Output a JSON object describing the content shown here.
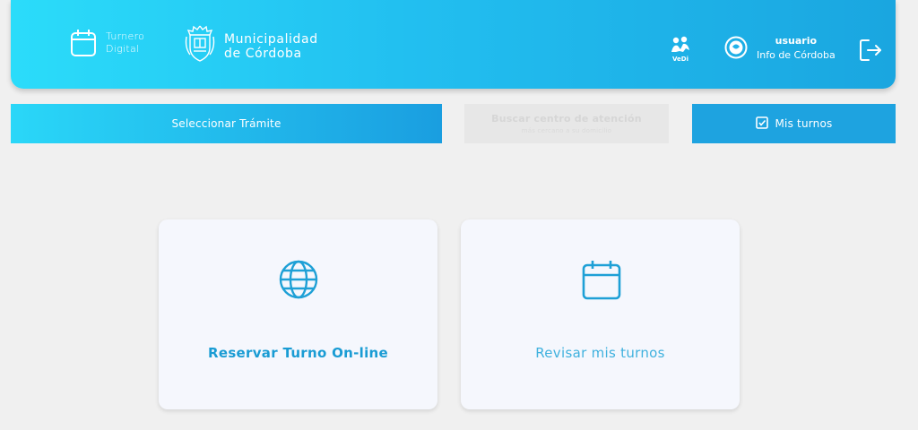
{
  "header": {
    "app_name_line1": "Turnero",
    "app_name_line2": "Digital",
    "municipality_line1": "Municipalidad",
    "municipality_line2": "de Córdoba",
    "vedi_label": "VeDi",
    "user_name": "usuario",
    "user_subtitle": "Info de Córdoba"
  },
  "nav": {
    "select_procedure": "Seleccionar Trámite",
    "center_title": "Buscar centro de atención",
    "center_subtitle": "más cercano a su domicilio",
    "my_appointments": "Mis turnos"
  },
  "cards": {
    "book_online": "Reservar Turno On-line",
    "review_appointments": "Revisar mis turnos"
  },
  "icons": {
    "app": "calendar-icon",
    "crest": "municipal-crest-icon",
    "vedi": "vedi-logo-icon",
    "avatar": "user-avatar-icon",
    "logout": "logout-icon",
    "check": "check-square-icon",
    "globe": "globe-icon",
    "calendar": "calendar-icon"
  },
  "colors": {
    "header_start": "#2bdcfa",
    "header_end": "#1aa6e0",
    "accent": "#1ea0d6",
    "background": "#f0f0f0",
    "card": "#f5f7fd"
  }
}
